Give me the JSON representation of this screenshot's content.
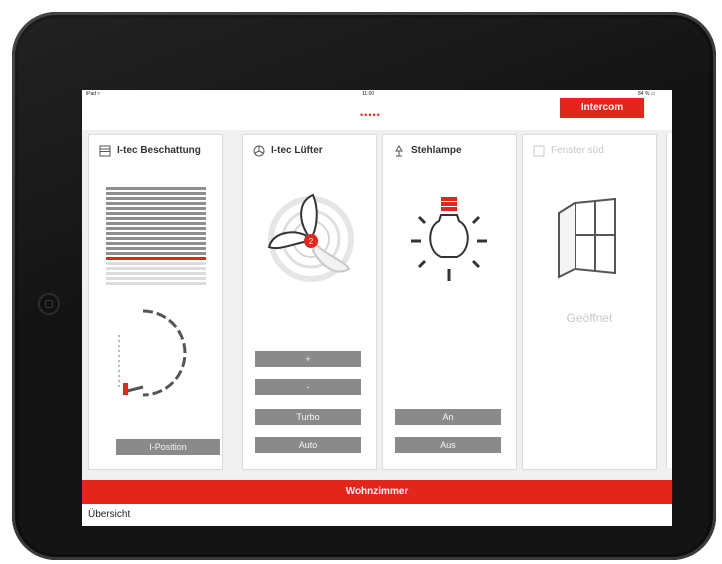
{
  "statusbar": {
    "left": "iPad ≈",
    "center": "11:00",
    "right": "84 % ▭"
  },
  "header": {
    "page_dots": "•••••",
    "intercom_label": "Intercom"
  },
  "cards": [
    {
      "title": "I-tec Beschattung",
      "icon": "blinds-icon",
      "buttons": [
        "I-Position"
      ]
    },
    {
      "title": "I-tec Lüfter",
      "icon": "fan-icon",
      "buttons": [
        "+",
        "-",
        "Turbo",
        "Auto"
      ]
    },
    {
      "title": "Stehlampe",
      "icon": "lamp-icon",
      "buttons": [
        "An",
        "Aus"
      ]
    },
    {
      "title": "Fenster süd",
      "icon": "window-icon",
      "status": "Geöffnet"
    }
  ],
  "room_title": "Wohnzimmer",
  "nav": {
    "overview_label": "Übersicht"
  },
  "colors": {
    "accent": "#e3261b",
    "button_gray": "#8a8a8a",
    "card_bg": "#ffffff",
    "screen_bg": "#f0f0f0"
  }
}
